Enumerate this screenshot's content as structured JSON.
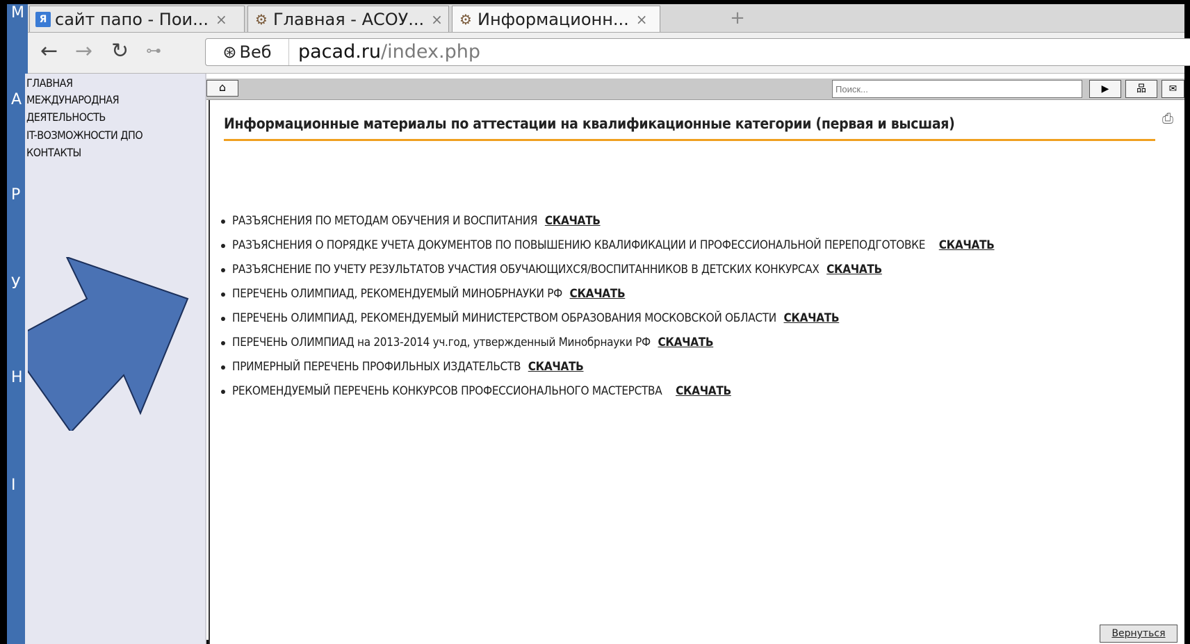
{
  "browser": {
    "tabs": [
      {
        "icon": "yandex-icon",
        "icon_text": "Я",
        "label": "сайт папо - Пои...",
        "active": false
      },
      {
        "icon": "site-icon",
        "label": "Главная - АСОУ...",
        "active": false
      },
      {
        "icon": "site-icon",
        "label": "Информационн...",
        "active": true
      }
    ],
    "close_glyph": "×",
    "new_tab_glyph": "+",
    "web_chip": "Веб",
    "url_domain": "pacad.ru",
    "url_path": "/index.php"
  },
  "left_strip_letters": [
    "М",
    "А",
    "Р",
    "У",
    "Н",
    "І"
  ],
  "sidebar": {
    "items": [
      "ГЛАВНАЯ",
      "МЕЖДУНАРОДНАЯ ДЕЯТЕЛЬНОСТЬ",
      "IT-ВОЗМОЖНОСТИ ДПО",
      "КОНТАКТЫ"
    ]
  },
  "toolbar": {
    "search_placeholder": "Поиск..."
  },
  "main": {
    "title": "Информационные материалы по аттестации на квалификационные категории (первая и высшая)",
    "documents": [
      {
        "text": "РАЗЪЯСНЕНИЯ ПО МЕТОДАМ ОБУЧЕНИЯ И ВОСПИТАНИЯ",
        "link": "СКАЧАТЬ"
      },
      {
        "text": "РАЗЪЯСНЕНИЯ О ПОРЯДКЕ УЧЕТА ДОКУМЕНТОВ ПО ПОВЫШЕНИЮ КВАЛИФИКАЦИИ И ПРОФЕССИОНАЛЬНОЙ ПЕРЕПОДГОТОВКЕ",
        "link": "СКАЧАТЬ"
      },
      {
        "text": "РАЗЪЯСНЕНИЕ ПО УЧЕТУ РЕЗУЛЬТАТОВ УЧАСТИЯ ОБУЧАЮЩИХСЯ/ВОСПИТАННИКОВ В ДЕТСКИХ КОНКУРСАХ",
        "link": "СКАЧАТЬ"
      },
      {
        "text": "ПЕРЕЧЕНЬ ОЛИМПИАД, РЕКОМЕНДУЕМЫЙ МИНОБРНАУКИ РФ",
        "link": "СКАЧАТЬ"
      },
      {
        "text": "ПЕРЕЧЕНЬ ОЛИМПИАД, РЕКОМЕНДУЕМЫЙ МИНИСТЕРСТВОМ ОБРАЗОВАНИЯ МОСКОВСКОЙ ОБЛАСТИ",
        "link": "СКАЧАТЬ"
      },
      {
        "text": "ПЕРЕЧЕНЬ ОЛИМПИАД на 2013-2014 уч.год, утвержденный Минобрнауки РФ",
        "link": "СКАЧАТЬ"
      },
      {
        "text": "ПРИМЕРНЫЙ ПЕРЕЧЕНЬ ПРОФИЛЬНЫХ ИЗДАТЕЛЬСТВ",
        "link": "СКАЧАТЬ"
      },
      {
        "text": "РЕКОМЕНДУЕМЫЙ ПЕРЕЧЕНЬ КОНКУРСОВ ПРОФЕССИОНАЛЬНОГО МАСТЕРСТВА",
        "link": "СКАЧАТЬ"
      }
    ],
    "back_link": "Вернуться"
  },
  "colors": {
    "title_underline": "#f0a020",
    "sidebar_bg": "#e6e7f1",
    "arrow_fill": "#4a72b4",
    "arrow_stroke": "#1b2f5a"
  }
}
